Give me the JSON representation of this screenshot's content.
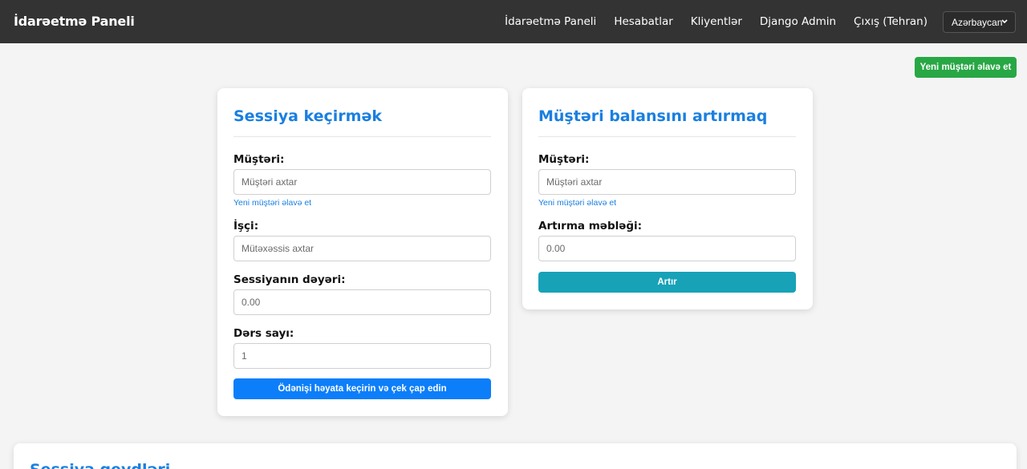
{
  "navbar": {
    "brand": "İdarəetmə Paneli",
    "links": [
      "İdarəetmə Paneli",
      "Hesabatlar",
      "Kliyentlər",
      "Django Admin",
      "Çıxış (Tehran)"
    ],
    "language": "Azərbaycan"
  },
  "top_actions": {
    "add_client_label": "Yeni müştəri əlavə et"
  },
  "session_card": {
    "title": "Sessiya keçirmək",
    "client_label": "Müştəri:",
    "client_placeholder": "Müştəri axtar",
    "add_client_link": "Yeni müştəri əlavə et",
    "worker_label": "İşçi:",
    "worker_placeholder": "Mütəxəssis axtar",
    "cost_label": "Sessiyanın dəyəri:",
    "cost_value": "0.00",
    "lessons_label": "Dərs sayı:",
    "lessons_value": "1",
    "submit_label": "Ödənişi həyata keçirin və çek çap edin"
  },
  "balance_card": {
    "title": "Müştəri balansını artırmaq",
    "client_label": "Müştəri:",
    "client_placeholder": "Müştəri axtar",
    "add_client_link": "Yeni müştəri əlavə et",
    "amount_label": "Artırma məbləği:",
    "amount_value": "0.00",
    "submit_label": "Artır"
  },
  "bottom_card": {
    "title": "Sessiya qeydləri"
  },
  "colors": {
    "navbar_bg": "#333333",
    "accent_blue": "#1a7fe0",
    "primary_button": "#0d7ef9",
    "success_button": "#28a745",
    "info_button": "#17a2b8"
  }
}
